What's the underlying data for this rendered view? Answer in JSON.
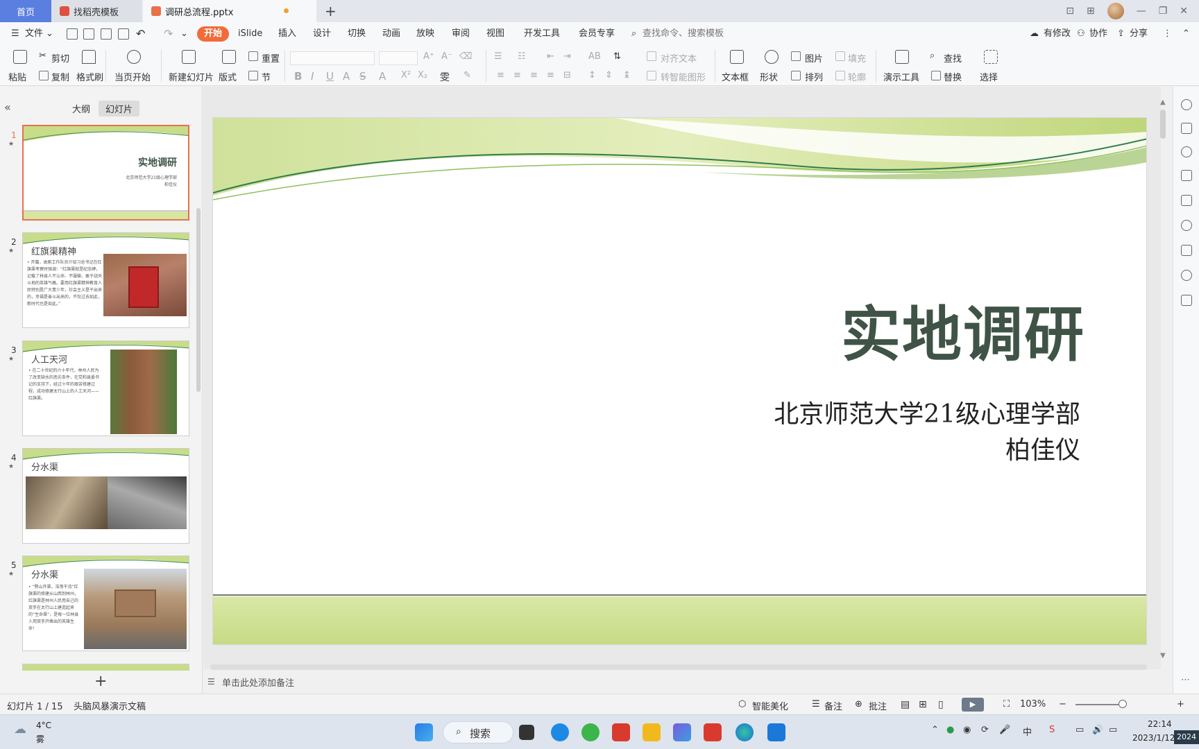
{
  "tabs": {
    "home": "首页",
    "template": "找稻壳模板",
    "file": "调研总流程.pptx"
  },
  "menu": {
    "file": "文件",
    "start": "开始",
    "islide": "iSlide",
    "insert": "插入",
    "design": "设计",
    "switch": "切换",
    "animation": "动画",
    "show": "放映",
    "review": "审阅",
    "view": "视图",
    "dev": "开发工具",
    "member": "会员专享",
    "search": "查找命令、搜索模板",
    "modified": "有修改",
    "collab": "协作",
    "share": "分享"
  },
  "ribbon": {
    "paste": "粘贴",
    "cut": "剪切",
    "copy": "复制",
    "format_painter": "格式刷",
    "from_current": "当页开始",
    "new_slide": "新建幻灯片",
    "layout": "版式",
    "section": "节",
    "reset": "重置",
    "align_text": "对齐文本",
    "smart_shape": "转智能图形",
    "textbox": "文本框",
    "shape": "形状",
    "picture": "图片",
    "fill": "填充",
    "arrange": "排列",
    "outline": "轮廓",
    "present_tools": "演示工具",
    "find": "查找",
    "replace": "替换",
    "select": "选择"
  },
  "panel": {
    "outline": "大纲",
    "slides": "幻灯片"
  },
  "thumbs": {
    "t1": {
      "num": "1",
      "title": "实地调研",
      "sub": "北京师范大学21级心理学部",
      "name": "柏佳仪"
    },
    "t2": {
      "num": "2",
      "title": "红旗渠精神",
      "text": "• 开篇，由刚工作队员介绍习总书记在红旗渠考察时强调：“红旗渠就是纪念碑，记载了林县人不认命、不服输、敢于战天斗地的英雄气概。要用红旗渠精神教育人民特别是广大青少年，社会主义是干出来的，幸福是奋斗出来的，不仅过去如此，新时代也是如此。”"
    },
    "t3": {
      "num": "3",
      "title": "人工天河",
      "text": "• 在二十世纪的六十年代，林州人民为了改变缺水的恶劣条件，在党和县委书记的支持下，经过十年的艰苦修建过程，成功修建太行山上的人工天河——红旗渠。"
    },
    "t4": {
      "num": "4",
      "title": "分水渠"
    },
    "t5": {
      "num": "5",
      "title": "分水渠",
      "text": "• “劈山开渠，浩荡干流”红旗渠的修建从山西到林州，红旗渠是林州人民用自己的双手在太行山上建造起来的“生命渠”，是每一位林县人用双手开凿出的英雄生命！"
    }
  },
  "slide": {
    "title": "实地调研",
    "subtitle": "北京师范大学21级心理学部",
    "author": "柏佳仪"
  },
  "notes": "单击此处添加备注",
  "status": {
    "slide_count": "幻灯片 1 / 15",
    "theme": "头脑风暴演示文稿",
    "beautify": "智能美化",
    "notes": "备注",
    "comment": "批注",
    "zoom": "103%"
  },
  "taskbar": {
    "temp": "4°C",
    "weather": "雾",
    "search": "搜索",
    "time": "22:14",
    "date": "2023/1/12",
    "year": "2024"
  }
}
